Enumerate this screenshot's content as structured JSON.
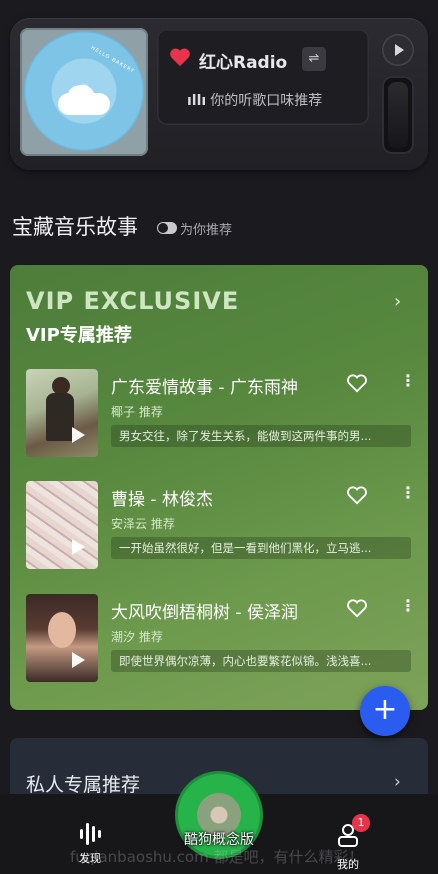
{
  "radio": {
    "title": "红心Radio",
    "subtitle": "你的听歌口味推荐",
    "album_text": "HELLO BAKERY"
  },
  "section": {
    "title": "宝藏音乐故事",
    "toggle_label": "为你推荐"
  },
  "vip": {
    "title_en": "VIP EXCLUSIVE",
    "title_cn": "VIP专属推荐",
    "songs": [
      {
        "title": "广东爱情故事 - 广东雨神",
        "recommender": "椰子 推荐",
        "desc": "男女交往，除了发生关系，能做到这两件事的男..."
      },
      {
        "title": "曹操 - 林俊杰",
        "recommender": "安泽云 推荐",
        "desc": "一开始虽然很好，但是一看到他们黑化，立马逃..."
      },
      {
        "title": "大风吹倒梧桐树 - 侯泽润",
        "recommender": "潮汐 推荐",
        "desc": "即使世界偶尔凉薄，内心也要繁花似锦。浅浅喜..."
      }
    ]
  },
  "private": {
    "title": "私人专属推荐"
  },
  "nav": {
    "find_label": "发现",
    "center_label": "酷狗概念版",
    "mine_label": "我的",
    "badge_count": "1"
  },
  "watermark": "fuqianbaoshu.com  都是吧，有什么精彩！",
  "colors": {
    "vip_green": "#58893f",
    "fab_blue": "#2a5cf0",
    "heart_red": "#e8334a",
    "center_green": "#26b34a"
  }
}
